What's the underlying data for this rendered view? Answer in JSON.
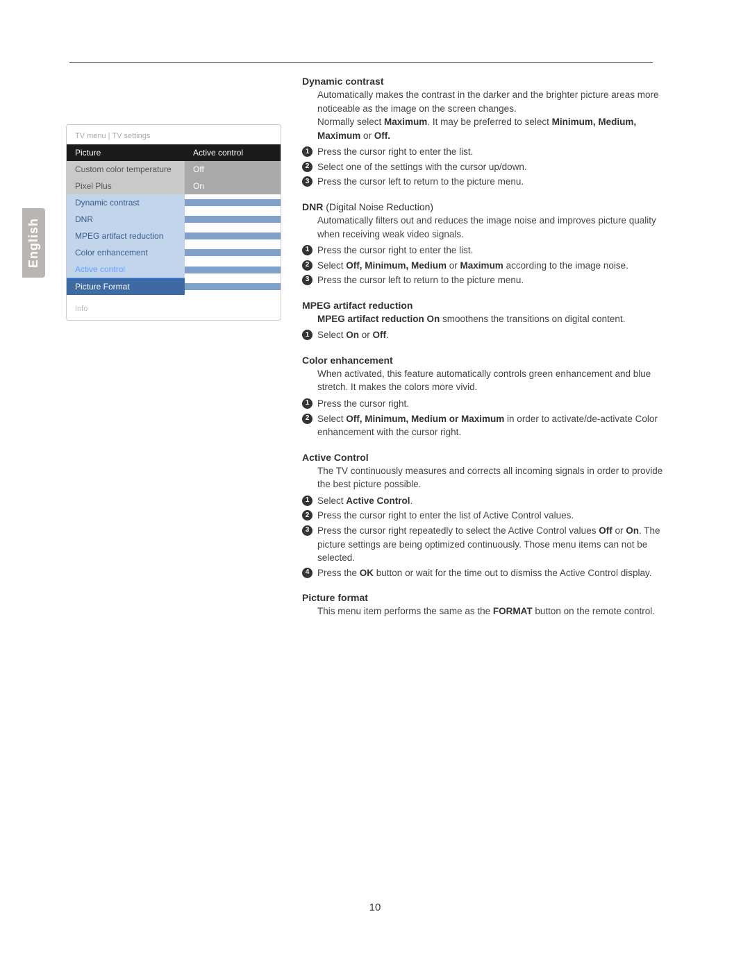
{
  "side_tab": "English",
  "page_number": "10",
  "menu": {
    "breadcrumb": "TV menu  |  TV settings",
    "header_left": "Picture",
    "header_right": "Active control",
    "rows": [
      {
        "label": "Custom color temperature",
        "value": "Off"
      },
      {
        "label": "Pixel Plus",
        "value": "On"
      },
      {
        "label": "Dynamic contrast",
        "value": ""
      },
      {
        "label": "DNR",
        "value": ""
      },
      {
        "label": "MPEG artifact reduction",
        "value": ""
      },
      {
        "label": "Color enhancement",
        "value": ""
      },
      {
        "label": "Active control",
        "value": ""
      },
      {
        "label": "Picture Format",
        "value": ""
      }
    ],
    "info": "Info"
  },
  "sections": {
    "s1": {
      "title": "Dynamic contrast",
      "body_a": "Automatically makes the contrast in the darker and the brighter picture areas more noticeable as the image on the screen changes.",
      "body_b_pre": "Normally select ",
      "body_b_bold1": "Maximum",
      "body_b_mid": ". It may be preferred to select ",
      "body_b_bold2": "Minimum, Medium, Maximum",
      "body_b_or": " or ",
      "body_b_bold3": "Off.",
      "step1": "Press the cursor right to enter the list.",
      "step2": "Select one of the settings with the cursor up/down.",
      "step3": "Press the cursor left to return to the picture menu."
    },
    "s2": {
      "title_bold": "DNR",
      "title_rest": " (Digital Noise Reduction)",
      "body": "Automatically filters out and reduces the image noise and improves picture quality when receiving weak video signals.",
      "step1": "Press the cursor right to enter the list.",
      "step2_pre": "Select ",
      "step2_bold": "Off, Minimum, Medium",
      "step2_mid": " or ",
      "step2_bold2": "Maximum",
      "step2_post": " according to the image noise.",
      "step3": "Press the cursor left to return to the picture menu."
    },
    "s3": {
      "title": "MPEG artifact reduction",
      "body_bold": "MPEG artifact reduction On",
      "body_rest": " smoothens the transitions on digital content.",
      "step1_pre": "Select ",
      "step1_bold1": "On",
      "step1_mid": " or ",
      "step1_bold2": "Off",
      "step1_post": "."
    },
    "s4": {
      "title": "Color enhancement",
      "body": "When activated, this feature automatically controls green enhancement and blue stretch. It makes the colors more vivid.",
      "step1": "Press the cursor right.",
      "step2_pre": "Select ",
      "step2_bold": "Off, Minimum, Medium or Maximum",
      "step2_post": " in order to activate/de-activate Color enhancement with the cursor right."
    },
    "s5": {
      "title": "Active Control",
      "body": "The TV continuously measures and corrects all incoming signals in order to provide the best picture possible.",
      "step1_pre": "Select ",
      "step1_bold": "Active Control",
      "step1_post": ".",
      "step2": "Press the cursor right to enter the list of Active Control values.",
      "step3_pre": "Press the cursor right repeatedly to select the Active Control values ",
      "step3_bold1": "Off",
      "step3_mid": " or ",
      "step3_bold2": "On",
      "step3_post": ". The picture settings are being optimized continuously. Those menu items can not be selected.",
      "step4_pre": "Press the ",
      "step4_bold": "OK",
      "step4_post": " button or wait for the time out to dismiss the Active Control display."
    },
    "s6": {
      "title": "Picture format",
      "body_pre": "This menu item performs the same as the ",
      "body_bold": "FORMAT",
      "body_post": " button on the remote control."
    }
  }
}
